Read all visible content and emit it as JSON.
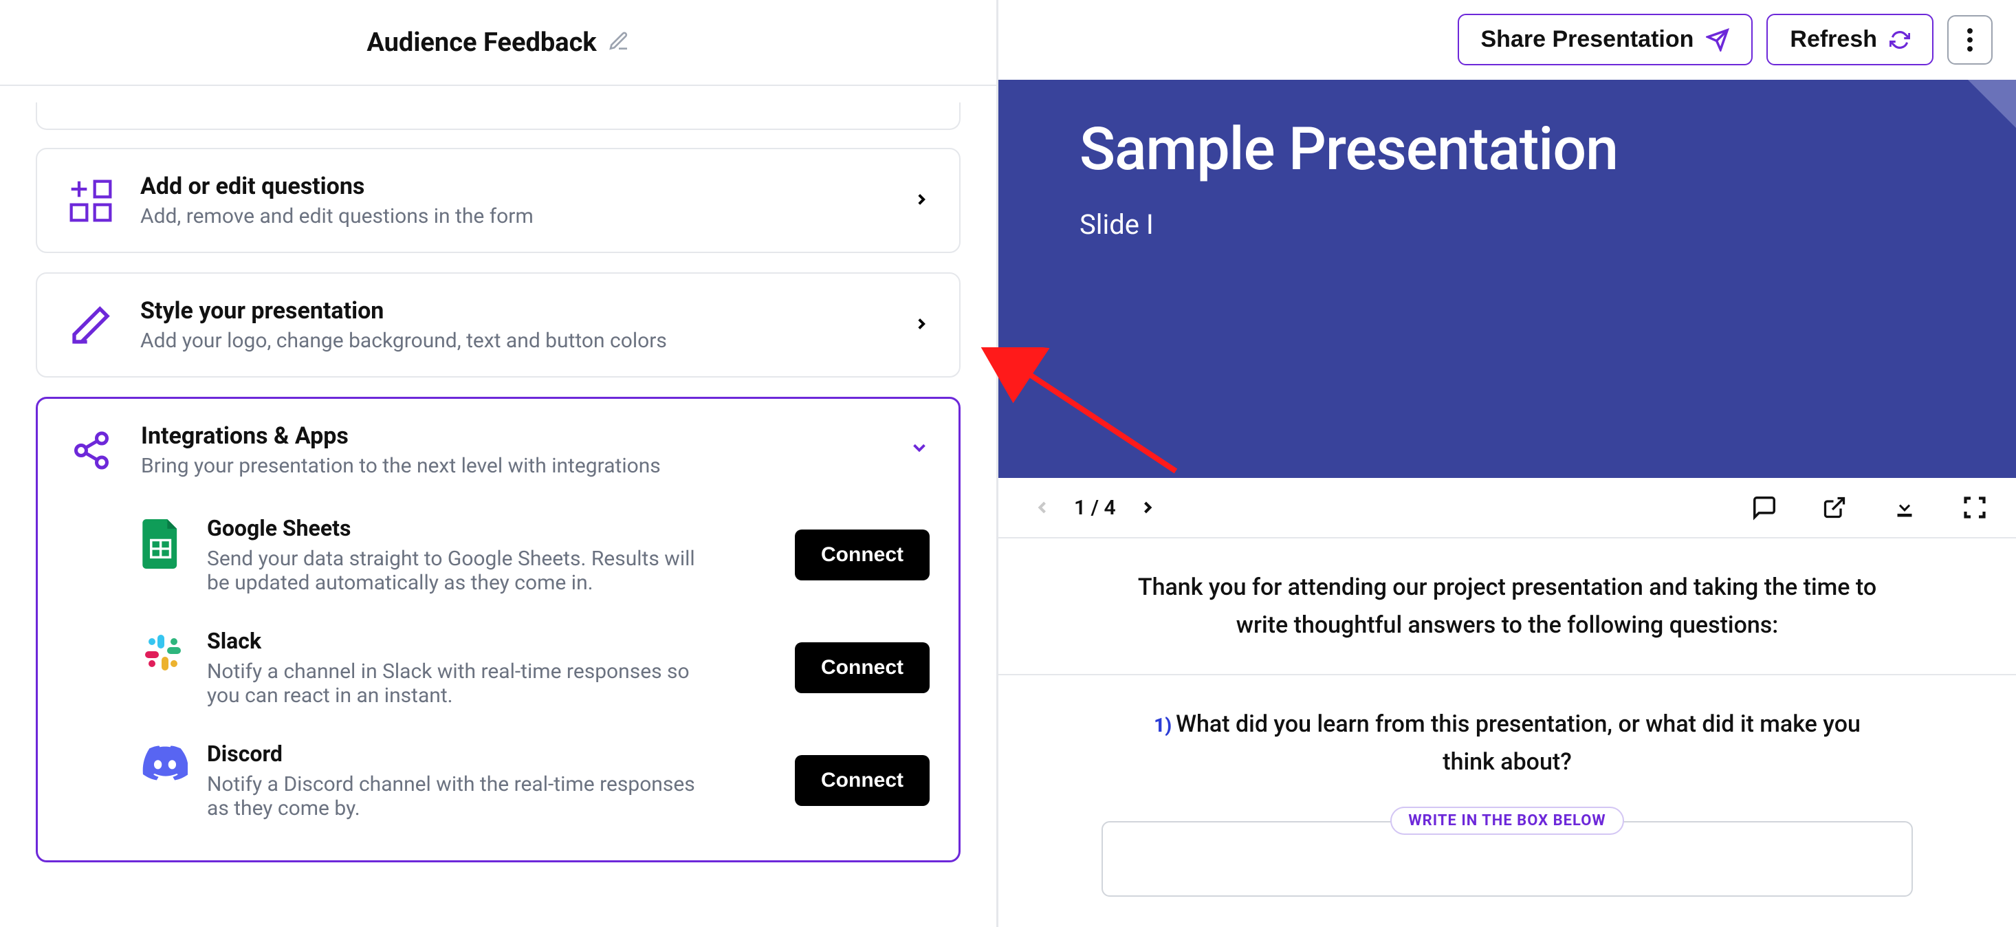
{
  "header": {
    "title": "Audience Feedback",
    "share_label": "Share Presentation",
    "refresh_label": "Refresh"
  },
  "cards": {
    "questions": {
      "title": "Add or edit questions",
      "sub": "Add, remove and edit questions in the form"
    },
    "style": {
      "title": "Style your presentation",
      "sub": "Add your logo, change background, text and button colors"
    },
    "integrations": {
      "title": "Integrations & Apps",
      "sub": "Bring your presentation to the next level with integrations"
    }
  },
  "integrations": [
    {
      "name": "Google Sheets",
      "desc": "Send your data straight to Google Sheets. Results will be updated automatically as they come in.",
      "button": "Connect"
    },
    {
      "name": "Slack",
      "desc": "Notify a channel in Slack with real-time responses so you can react in an instant.",
      "button": "Connect"
    },
    {
      "name": "Discord",
      "desc": "Notify a Discord channel with the real-time responses as they come by.",
      "button": "Connect"
    }
  ],
  "slide": {
    "title": "Sample Presentation",
    "subtitle": "Slide I",
    "page": "1 / 4",
    "intro": "Thank you for attending our project presentation and taking the time to write thoughtful answers to the following questions:",
    "q1_num": "1)",
    "q1": "What did you learn from this presentation, or what did it make you think about?",
    "pill": "WRITE IN THE BOX BELOW"
  }
}
